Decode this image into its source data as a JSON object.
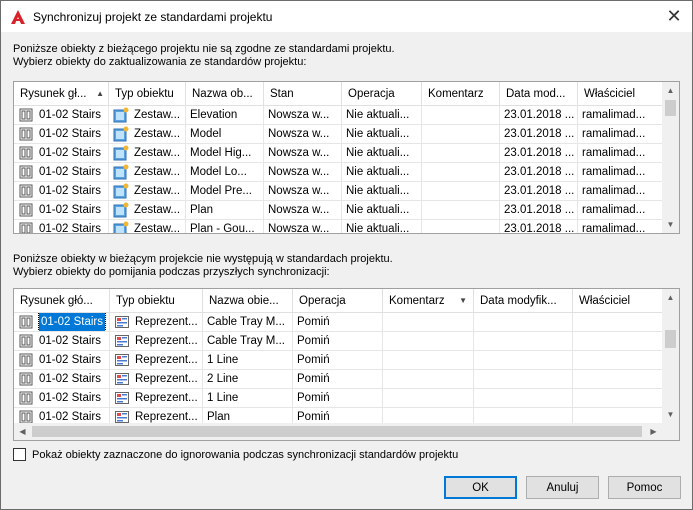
{
  "window": {
    "title": "Synchronizuj projekt ze standardami projektu"
  },
  "top_section": {
    "desc_line1": "Poniższe obiekty z bieżącego projektu nie są zgodne ze standardami projektu.",
    "desc_line2": "Wybierz obiekty do zaktualizowania ze standardów projektu:",
    "columns": [
      "Rysunek gł...",
      "Typ obiektu",
      "Nazwa ob...",
      "Stan",
      "Operacja",
      "Komentarz",
      "Data mod...",
      "Właściciel"
    ],
    "rows": [
      {
        "drawing": "01-02 Stairs",
        "type": "Zestaw...",
        "name": "Elevation",
        "state": "Nowsza w...",
        "operation": "Nie aktuali...",
        "comment": "",
        "date": "23.01.2018 ...",
        "owner": "ramalimad..."
      },
      {
        "drawing": "01-02 Stairs",
        "type": "Zestaw...",
        "name": "Model",
        "state": "Nowsza w...",
        "operation": "Nie aktuali...",
        "comment": "",
        "date": "23.01.2018 ...",
        "owner": "ramalimad..."
      },
      {
        "drawing": "01-02 Stairs",
        "type": "Zestaw...",
        "name": "Model Hig...",
        "state": "Nowsza w...",
        "operation": "Nie aktuali...",
        "comment": "",
        "date": "23.01.2018 ...",
        "owner": "ramalimad..."
      },
      {
        "drawing": "01-02 Stairs",
        "type": "Zestaw...",
        "name": "Model Lo...",
        "state": "Nowsza w...",
        "operation": "Nie aktuali...",
        "comment": "",
        "date": "23.01.2018 ...",
        "owner": "ramalimad..."
      },
      {
        "drawing": "01-02 Stairs",
        "type": "Zestaw...",
        "name": "Model Pre...",
        "state": "Nowsza w...",
        "operation": "Nie aktuali...",
        "comment": "",
        "date": "23.01.2018 ...",
        "owner": "ramalimad..."
      },
      {
        "drawing": "01-02 Stairs",
        "type": "Zestaw...",
        "name": "Plan",
        "state": "Nowsza w...",
        "operation": "Nie aktuali...",
        "comment": "",
        "date": "23.01.2018 ...",
        "owner": "ramalimad..."
      },
      {
        "drawing": "01-02 Stairs",
        "type": "Zestaw...",
        "name": "Plan - Gou...",
        "state": "Nowsza w...",
        "operation": "Nie aktuali...",
        "comment": "",
        "date": "23.01.2018 ...",
        "owner": "ramalimad..."
      }
    ]
  },
  "bottom_section": {
    "desc_line1": "Poniższe obiekty w bieżącym projekcie nie występują w standardach projektu.",
    "desc_line2": "Wybierz obiekty do pomijania podczas przyszłych synchronizacji:",
    "columns": [
      "Rysunek głó...",
      "Typ obiektu",
      "Nazwa obie...",
      "Operacja",
      "Komentarz",
      "Data modyfik...",
      "Właściciel"
    ],
    "rows": [
      {
        "drawing": "01-02 Stairs",
        "type": "Reprezent...",
        "name": "Cable Tray M...",
        "operation": "Pomiń"
      },
      {
        "drawing": "01-02 Stairs",
        "type": "Reprezent...",
        "name": "Cable Tray M...",
        "operation": "Pomiń"
      },
      {
        "drawing": "01-02 Stairs",
        "type": "Reprezent...",
        "name": "1 Line",
        "operation": "Pomiń"
      },
      {
        "drawing": "01-02 Stairs",
        "type": "Reprezent...",
        "name": "2 Line",
        "operation": "Pomiń"
      },
      {
        "drawing": "01-02 Stairs",
        "type": "Reprezent...",
        "name": "1 Line",
        "operation": "Pomiń"
      },
      {
        "drawing": "01-02 Stairs",
        "type": "Reprezent...",
        "name": "Plan",
        "operation": "Pomiń"
      }
    ]
  },
  "checkbox": {
    "label": "Pokaż obiekty zaznaczone do ignorowania podczas synchronizacji standardów projektu",
    "checked": false
  },
  "buttons": {
    "ok": "OK",
    "cancel": "Anuluj",
    "help": "Pomoc"
  },
  "colors": {
    "accent": "#0078d7",
    "app_icon": "#d9232a"
  }
}
